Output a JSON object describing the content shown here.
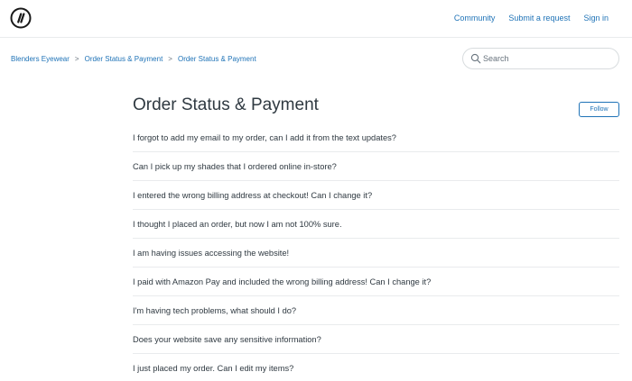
{
  "header": {
    "logo_icon": "double-slash-logo-icon",
    "nav": [
      {
        "label": "Community"
      },
      {
        "label": "Submit a request"
      },
      {
        "label": "Sign in"
      }
    ]
  },
  "breadcrumb": {
    "items": [
      {
        "label": "Blenders Eyewear"
      },
      {
        "label": "Order Status & Payment"
      },
      {
        "label": "Order Status & Payment"
      }
    ],
    "separator": ">"
  },
  "search": {
    "icon": "search-icon",
    "placeholder": "Search",
    "value": ""
  },
  "section": {
    "title": "Order Status & Payment",
    "follow_label": "Follow"
  },
  "articles": [
    {
      "title": "I forgot to add my email to my order, can I add it from the text updates?"
    },
    {
      "title": "Can I pick up my shades that I ordered online in-store?"
    },
    {
      "title": "I entered the wrong billing address at checkout! Can I change it?"
    },
    {
      "title": "I thought I placed an order, but now I am not 100% sure."
    },
    {
      "title": "I am having issues accessing the website!"
    },
    {
      "title": "I paid with Amazon Pay and included the wrong billing address! Can I change it?"
    },
    {
      "title": "I'm having tech problems, what should I do?"
    },
    {
      "title": "Does your website save any sensitive information?"
    },
    {
      "title": "I just placed my order. Can I edit my items?"
    }
  ],
  "colors": {
    "link": "#1f73b7",
    "text": "#2f3941",
    "divider": "#e9ebed"
  }
}
